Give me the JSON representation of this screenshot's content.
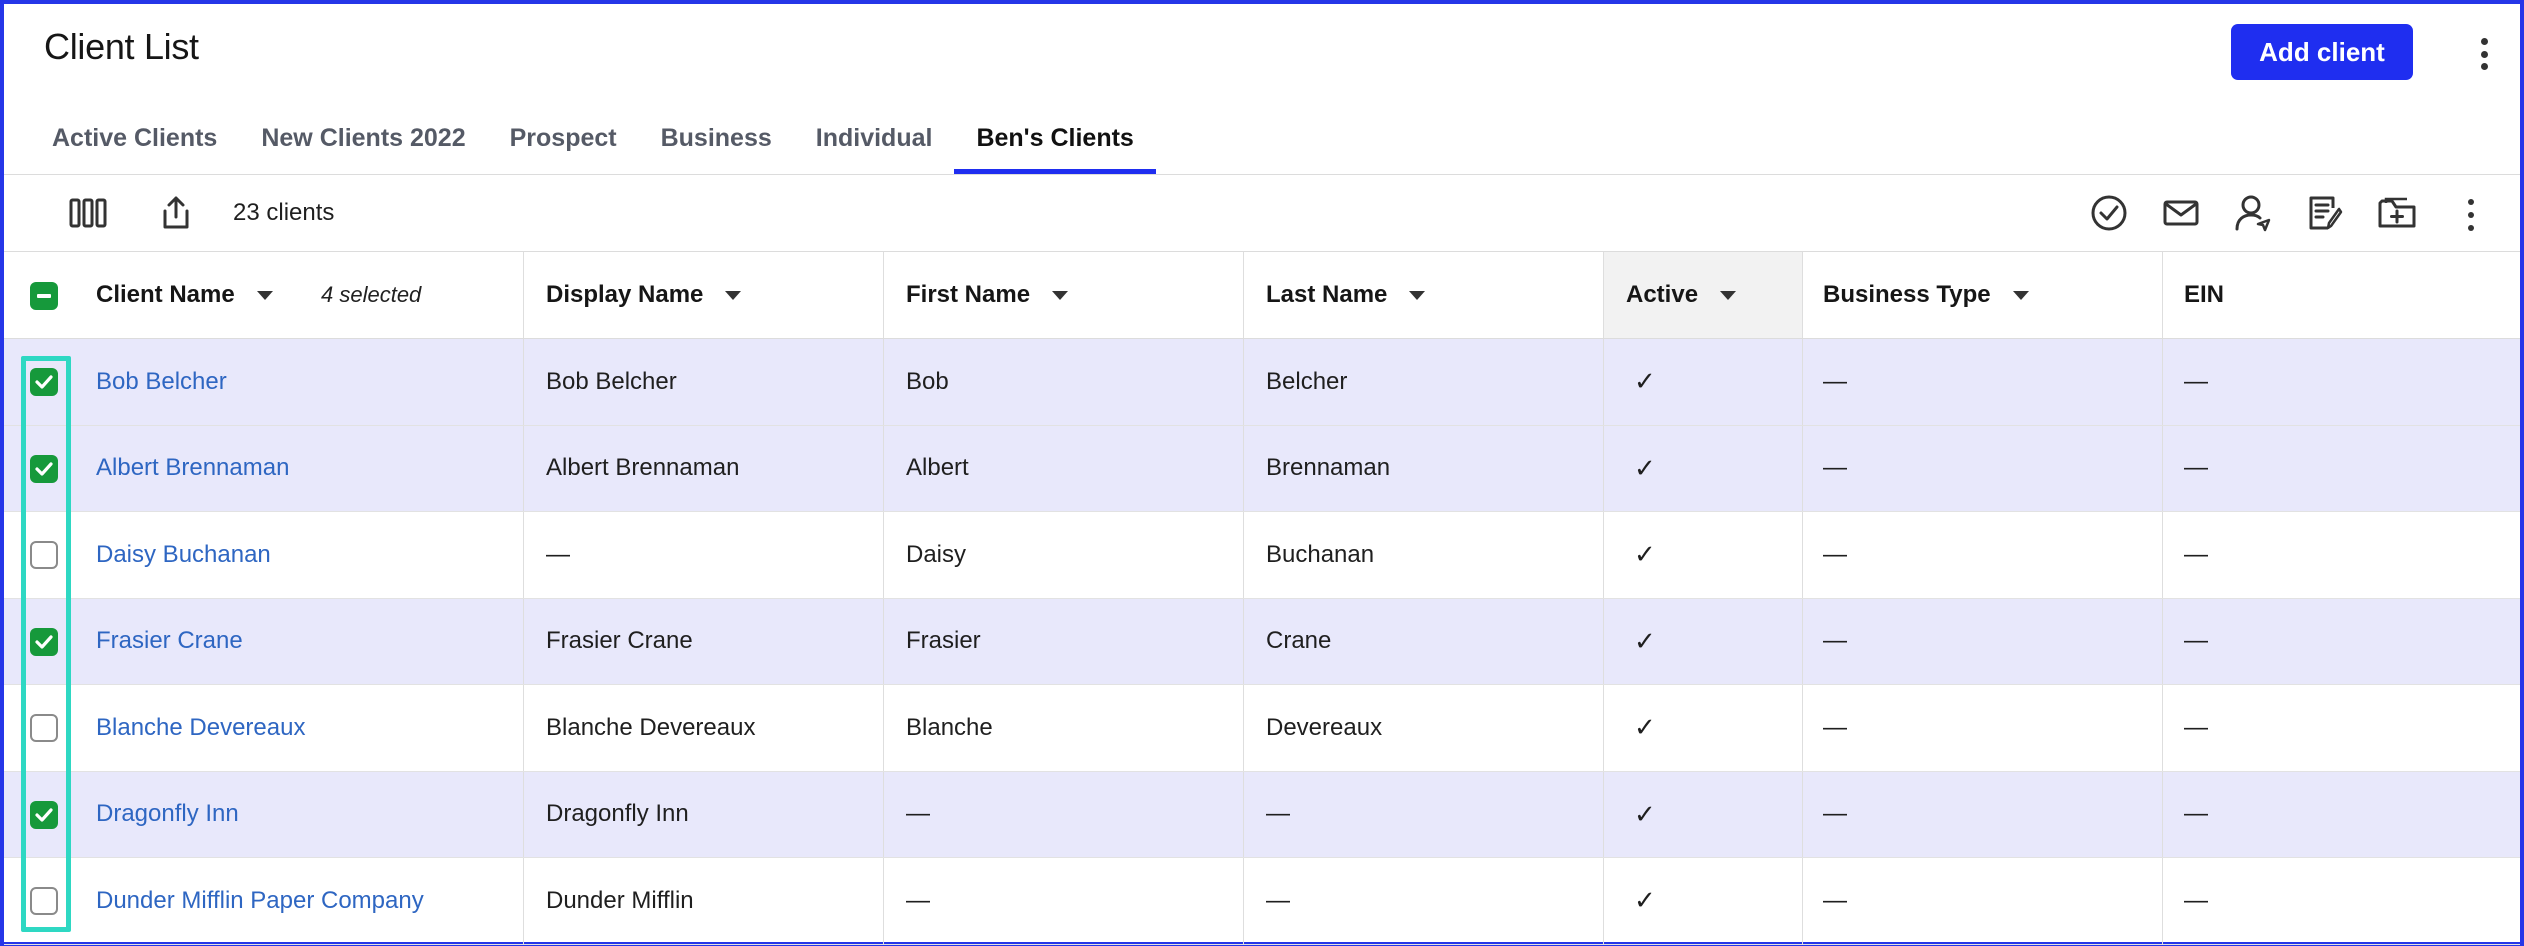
{
  "header": {
    "title": "Client List",
    "add_button": "Add client"
  },
  "tabs": [
    {
      "label": "Active Clients",
      "active": false
    },
    {
      "label": "New Clients 2022",
      "active": false
    },
    {
      "label": "Prospect",
      "active": false
    },
    {
      "label": "Business",
      "active": false
    },
    {
      "label": "Individual",
      "active": false
    },
    {
      "label": "Ben's Clients",
      "active": true
    }
  ],
  "toolbar": {
    "count": "23 clients",
    "icons": [
      "columns-icon",
      "export-icon",
      "check-circle-icon",
      "email-icon",
      "user-send-icon",
      "edit-document-icon",
      "add-folder-icon",
      "more-vertical-icon"
    ]
  },
  "table": {
    "columns": [
      "Client Name",
      "Display Name",
      "First Name",
      "Last Name",
      "Active",
      "Business Type",
      "EIN"
    ],
    "selected_label": "4 selected",
    "rows": [
      {
        "selected": true,
        "client": "Bob Belcher",
        "display": "Bob Belcher",
        "first": "Bob",
        "last": "Belcher",
        "active": "✓",
        "btype": "—",
        "ein": "—"
      },
      {
        "selected": true,
        "client": "Albert Brennaman",
        "display": "Albert Brennaman",
        "first": "Albert",
        "last": "Brennaman",
        "active": "✓",
        "btype": "—",
        "ein": "—"
      },
      {
        "selected": false,
        "client": "Daisy Buchanan",
        "display": "—",
        "first": "Daisy",
        "last": "Buchanan",
        "active": "✓",
        "btype": "—",
        "ein": "—"
      },
      {
        "selected": true,
        "client": "Frasier Crane",
        "display": "Frasier Crane",
        "first": "Frasier",
        "last": "Crane",
        "active": "✓",
        "btype": "—",
        "ein": "—"
      },
      {
        "selected": false,
        "client": "Blanche Devereaux",
        "display": "Blanche Devereaux",
        "first": "Blanche",
        "last": "Devereaux",
        "active": "✓",
        "btype": "—",
        "ein": "—"
      },
      {
        "selected": true,
        "client": "Dragonfly Inn",
        "display": "Dragonfly Inn",
        "first": "—",
        "last": "—",
        "active": "✓",
        "btype": "—",
        "ein": "—"
      },
      {
        "selected": false,
        "client": "Dunder Mifflin Paper Company",
        "display": "Dunder Mifflin",
        "first": "—",
        "last": "—",
        "active": "✓",
        "btype": "—",
        "ein": "—"
      }
    ]
  },
  "colors": {
    "accent": "#1f2ef0",
    "checkbox_green": "#16993b",
    "selected_row": "#e8e8fb",
    "link": "#2e66c2",
    "highlight": "#2ed8c3"
  }
}
